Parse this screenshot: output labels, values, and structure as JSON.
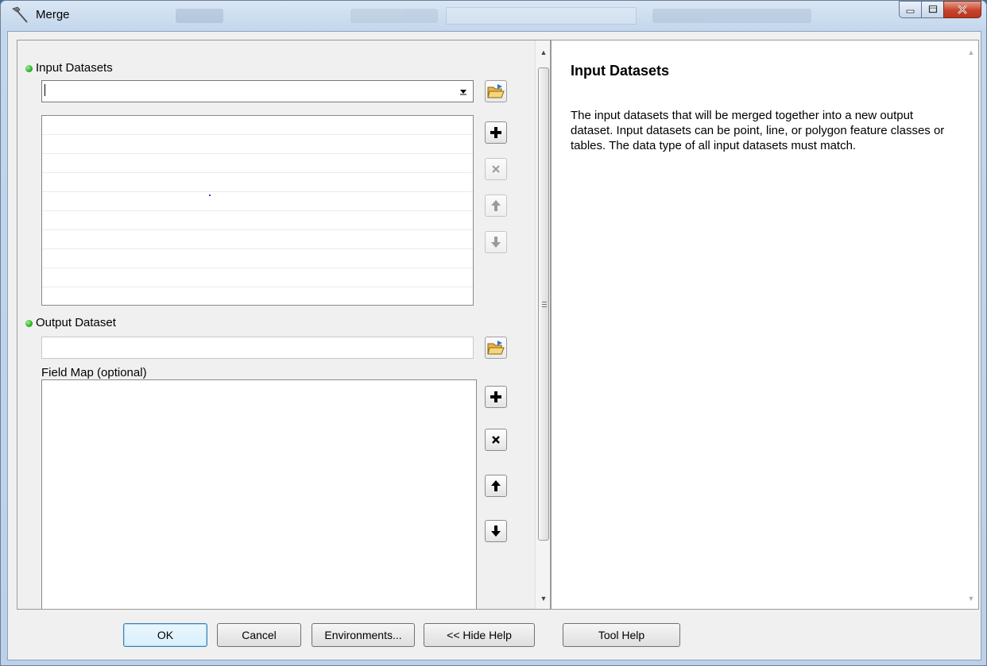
{
  "window": {
    "title": "Merge",
    "title_icon": "hammer-icon",
    "buttons": [
      "minimize-icon",
      "maximize-icon",
      "close-icon"
    ]
  },
  "params": {
    "input_datasets": {
      "label": "Input Datasets",
      "value": "",
      "required": true
    },
    "output_dataset": {
      "label": "Output Dataset",
      "value": "",
      "required": true
    },
    "field_map": {
      "label": "Field Map (optional)"
    }
  },
  "help": {
    "title": "Input Datasets",
    "body": "The input datasets that will be merged together into a new output dataset. Input datasets can be point, line, or polygon feature classes or tables. The data type of all input datasets must match."
  },
  "footer": {
    "ok": "OK",
    "cancel": "Cancel",
    "environments": "Environments...",
    "hide_help": "<< Hide Help",
    "tool_help": "Tool Help"
  },
  "colors": {
    "required_dot": "#1ea41a",
    "default_button_border": "#3c7fb1"
  }
}
